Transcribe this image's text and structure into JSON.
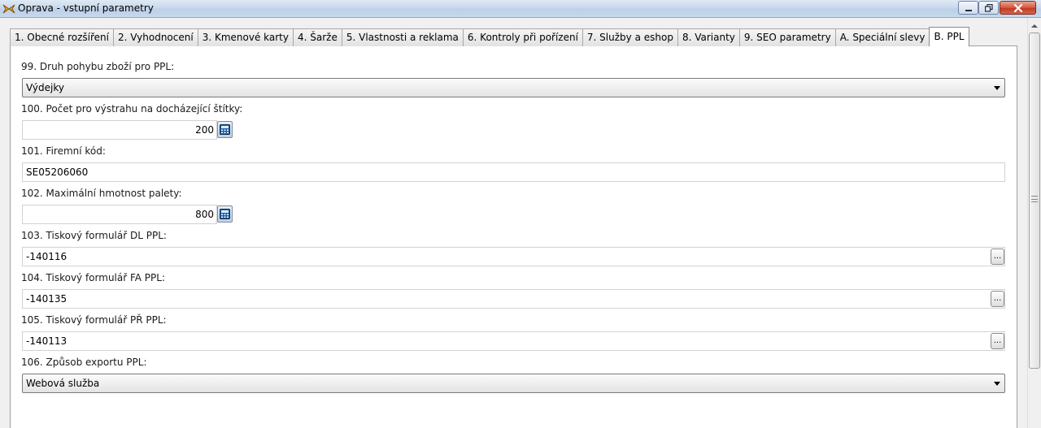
{
  "window": {
    "title": "Oprava - vstupní parametry",
    "icon": "app-arrows-icon"
  },
  "tabs": [
    {
      "label": "1. Obecné rozšíření",
      "active": false
    },
    {
      "label": "2. Vyhodnocení",
      "active": false
    },
    {
      "label": "3. Kmenové karty",
      "active": false
    },
    {
      "label": "4. Šarže",
      "active": false
    },
    {
      "label": "5. Vlastnosti a reklama",
      "active": false
    },
    {
      "label": "6. Kontroly při pořízení",
      "active": false
    },
    {
      "label": "7. Služby a eshop",
      "active": false
    },
    {
      "label": "8. Varianty",
      "active": false
    },
    {
      "label": "9. SEO parametry",
      "active": false
    },
    {
      "label": "A. Speciální slevy",
      "active": false
    },
    {
      "label": "B. PPL",
      "active": true
    }
  ],
  "fields": {
    "f99": {
      "label": "99. Druh pohybu zboží pro PPL:",
      "value": "Výdejky"
    },
    "f100": {
      "label": "100. Počet pro výstrahu na docházející štítky:",
      "value": "200"
    },
    "f101": {
      "label": "101. Firemní kód:",
      "value": "SE05206060"
    },
    "f102": {
      "label": "102. Maximální hmotnost palety:",
      "value": "800"
    },
    "f103": {
      "label": "103. Tiskový formulář DL PPL:",
      "value": "-140116",
      "button": "..."
    },
    "f104": {
      "label": "104. Tiskový formulář FA PPL:",
      "value": "-140135",
      "button": "..."
    },
    "f105": {
      "label": "105. Tiskový formulář PŘ PPL:",
      "value": "-140113",
      "button": "..."
    },
    "f106": {
      "label": "106. Způsob exportu PPL:",
      "value": "Webová služba"
    }
  },
  "colors": {
    "titlebar": "#c9d9ec",
    "close_button": "#d6563d",
    "panel_bg": "#ffffff"
  }
}
